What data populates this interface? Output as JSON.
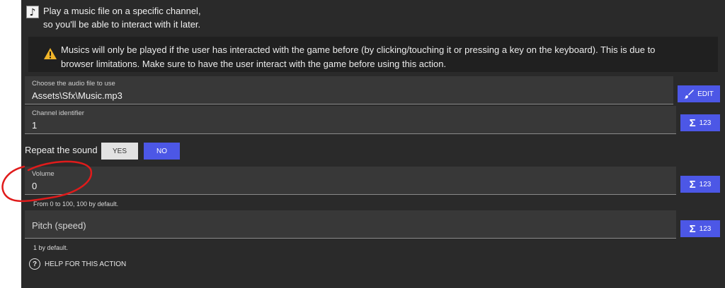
{
  "header": {
    "description_line1": "Play a music file on a specific channel,",
    "description_line2": "so you'll be able to interact with it later.",
    "action_icon": "music-note-icon"
  },
  "warning": {
    "icon": "warning-triangle-icon",
    "color": "#f0b429",
    "text": "Musics will only be played if the user has interacted with the game before (by clicking/touching it or pressing a key on the keyboard). This is due to browser limitations. Make sure to have the user interact with the game before using this action."
  },
  "audio_file": {
    "label": "Choose the audio file to use",
    "value": "Assets\\Sfx\\Music.mp3",
    "button": "EDIT"
  },
  "channel": {
    "label": "Channel identifier",
    "value": "1",
    "button": "123"
  },
  "repeat": {
    "label": "Repeat the sound",
    "yes": "YES",
    "no": "NO",
    "selected": "NO"
  },
  "volume": {
    "label": "Volume",
    "value": "0",
    "helper": "From 0 to 100, 100 by default.",
    "button": "123"
  },
  "pitch": {
    "placeholder": "Pitch (speed)",
    "helper": "1 by default.",
    "button": "123"
  },
  "help": {
    "label": "HELP FOR THIS ACTION"
  },
  "colors": {
    "accent": "#4c57e6",
    "panel": "#2a2a2a",
    "annotation": "#e01b1b"
  }
}
